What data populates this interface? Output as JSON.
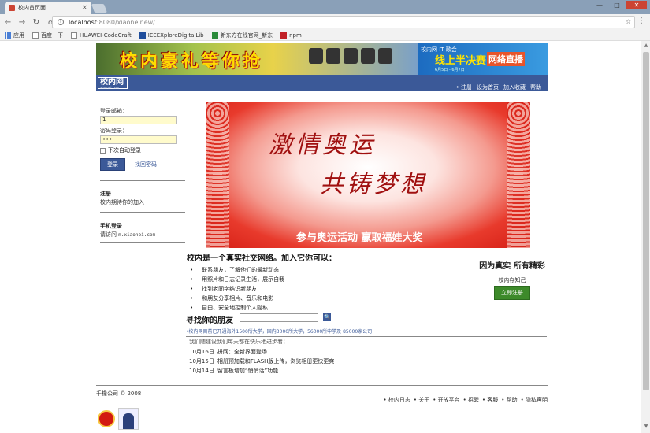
{
  "browser": {
    "tab_title": "校内首页面",
    "tab_close": "×",
    "url_host": "localhost",
    "url_rest": ":8080/xiaoneinew/",
    "window_controls": [
      "—",
      "□",
      "✕"
    ],
    "bookmarks": [
      {
        "label": "应用",
        "icon": "apps-icon"
      },
      {
        "label": "百度一下",
        "icon": "page-icon"
      },
      {
        "label": "HUAWEI-CodeCraft",
        "icon": "page-icon"
      },
      {
        "label": "IEEEXploreDigitalLib",
        "icon": "ieee-icon"
      },
      {
        "label": "新东方在线官网_新东",
        "icon": "xdf-icon"
      },
      {
        "label": "npm",
        "icon": "npm-icon"
      }
    ]
  },
  "ad": {
    "slogan": "校内豪礼等你抢",
    "right_small": "校内网 IT 歌会",
    "right_main": "线上半决赛",
    "right_tag": "网络直播",
    "right_date": "6月5日 - 6月7日"
  },
  "header": {
    "logo_name": "校内网",
    "logo_domain": "xiaonei.com",
    "nav": [
      "注册",
      "设为首页",
      "加入收藏",
      "帮助"
    ]
  },
  "login": {
    "email_label": "登录邮箱：",
    "email_value": "1",
    "password_label": "密码登录：",
    "password_value": "•••",
    "remember_label": "下次自动登录",
    "login_button": "登录",
    "forgot_link": "找回密码"
  },
  "sidebar": {
    "register_title": "注册",
    "register_text": "校内期待你的加入",
    "mobile_title": "手机登录",
    "mobile_text_prefix": "请访问",
    "mobile_domain": "m.xiaonei.com"
  },
  "hero": {
    "line1": "激情奥运",
    "line2": "共铸梦想",
    "line3": "参与奥运活动 赢取福娃大奖"
  },
  "intro": {
    "title": "校内是一个真实社交网络。加入它你可以：",
    "features": [
      "联系朋友，了解他们的最新动态",
      "用照片和日志记录生活，展示自我",
      "找到老同学结识新朋友",
      "和朋友分享相片、音乐和电影",
      "自由、安全地控制个人隐私"
    ]
  },
  "cta": {
    "title": "因为真实 所有精彩",
    "subtitle": "校内存知己",
    "register_button": "立即注册"
  },
  "find": {
    "title": "寻找你的朋友",
    "search_button": "🔍",
    "stats": "•校内网目前已开通海外1500所大学，国内3000所大学，56000所中学及 85000家公司"
  },
  "news": {
    "intro": "我们随建设我们每天都在快乐地进步着：",
    "items": [
      {
        "date": "10月16日",
        "text": "拼网：全新界面登场"
      },
      {
        "date": "10月15日",
        "text": "相册预加载和FLASH版上传，浏览相册更快更爽"
      },
      {
        "date": "10月14日",
        "text": "留言板增加“悄悄话”功能"
      }
    ]
  },
  "footer": {
    "copyright": "千橡公司 © 2008",
    "nav": [
      "校内日志",
      "关于",
      "开放平台",
      "招聘",
      "客服",
      "帮助",
      "隐私声明"
    ]
  }
}
